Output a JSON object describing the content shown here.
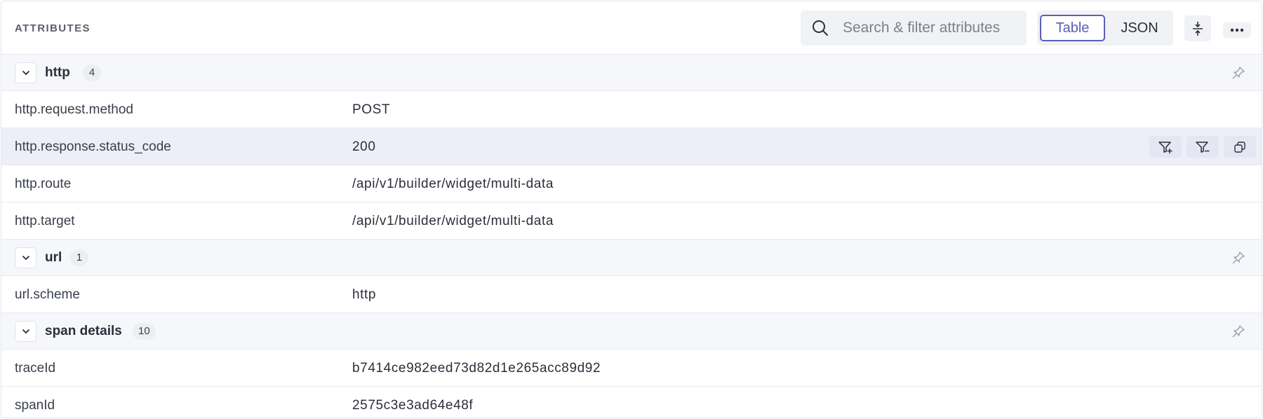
{
  "header": {
    "title": "ATTRIBUTES",
    "search_placeholder": "Search & filter attributes",
    "view_table": "Table",
    "view_json": "JSON"
  },
  "groups": [
    {
      "label": "http",
      "count": "4",
      "rows": [
        {
          "key": "http.request.method",
          "value": "POST"
        },
        {
          "key": "http.response.status_code",
          "value": "200"
        },
        {
          "key": "http.route",
          "value": "/api/v1/builder/widget/multi-data"
        },
        {
          "key": "http.target",
          "value": "/api/v1/builder/widget/multi-data"
        }
      ]
    },
    {
      "label": "url",
      "count": "1",
      "rows": [
        {
          "key": "url.scheme",
          "value": "http"
        }
      ]
    },
    {
      "label": "span details",
      "count": "10",
      "rows": [
        {
          "key": "traceId",
          "value": "b7414ce982eed73d82d1e265acc89d92"
        },
        {
          "key": "spanId",
          "value": "2575c3e3ad64e48f"
        }
      ]
    }
  ],
  "icons": {
    "search": "search-icon",
    "collapse": "collapse-rows-icon",
    "more": "more-horizontal-icon",
    "chevron": "chevron-down-icon",
    "pin": "pin-icon",
    "filter_in": "filter-plus-icon",
    "filter_out": "filter-minus-icon",
    "copy": "copy-icon"
  },
  "colors": {
    "accent": "#5a5fb8",
    "row_highlight": "#eceef8",
    "group_bg": "#f6f7fa"
  }
}
